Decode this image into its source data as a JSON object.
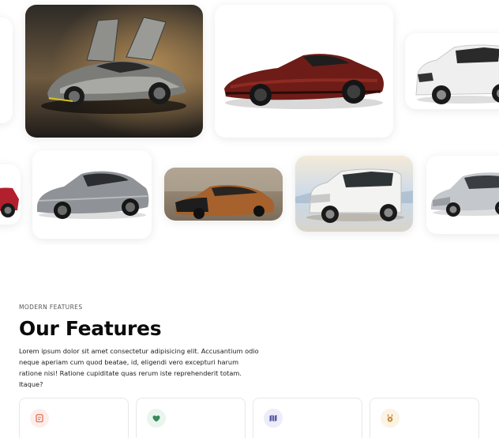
{
  "gallery": {
    "cards": [
      {
        "name": "car-card-edge-left-top",
        "image": "car-partial-edge"
      },
      {
        "name": "car-card-hypercar-gullwing",
        "image": "grey-hypercar-gullwing-doors"
      },
      {
        "name": "car-card-red-roadster",
        "image": "red-supercar-roadster"
      },
      {
        "name": "car-card-white-suv",
        "image": "white-luxury-suv"
      },
      {
        "name": "car-card-red-partial",
        "image": "red-sedan-partial"
      },
      {
        "name": "car-card-silver-sedan",
        "image": "silver-sedan"
      },
      {
        "name": "car-card-bronze-sedan",
        "image": "bronze-luxury-sedan-showroom"
      },
      {
        "name": "car-card-white-landcruiser",
        "image": "white-offroad-suv"
      },
      {
        "name": "car-card-silver-limo",
        "image": "silver-luxury-limousine"
      }
    ]
  },
  "features": {
    "eyebrow": "MODERN FEATURES",
    "title": "Our Features",
    "description": "Lorem ipsum dolor sit amet consectetur adipisicing elit. Accusantium odio neque aperiam cum quod beatae, id, eligendi vero excepturi harum ratione nisi! Ratione cupiditate quas rerum iste reprehenderit totam. Itaque?",
    "items": [
      {
        "icon": "document-icon",
        "icon_color": "#e2725b",
        "icon_bg": "#fdeeea"
      },
      {
        "icon": "heart-icon",
        "icon_color": "#3a8a5a",
        "icon_bg": "#e9f6ee"
      },
      {
        "icon": "map-icon",
        "icon_color": "#5a5aa8",
        "icon_bg": "#ececfa"
      },
      {
        "icon": "award-icon",
        "icon_color": "#c08a3a",
        "icon_bg": "#fbf3e4"
      }
    ]
  }
}
